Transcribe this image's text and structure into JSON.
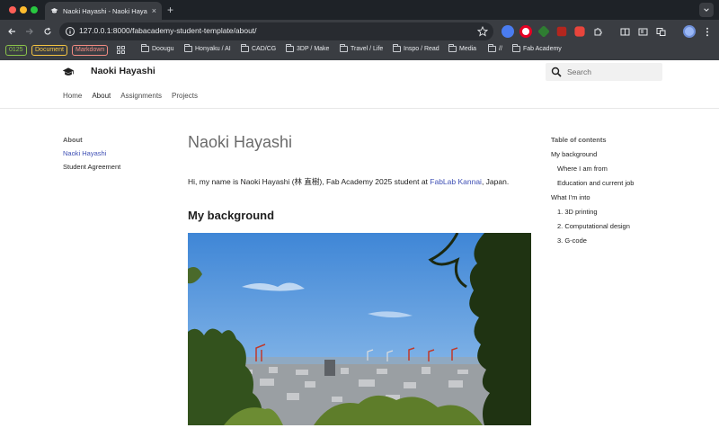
{
  "browser": {
    "tab_title": "Naoki Hayashi - Naoki Hayashi",
    "tab_close": "×",
    "new_tab": "+",
    "url": "127.0.0.1:8000/fabacademy-student-template/about/"
  },
  "bookmarks": {
    "tags": [
      {
        "label": "0125",
        "color": "#8bc34a"
      },
      {
        "label": "Document",
        "color": "#f5c542"
      },
      {
        "label": "Markdown",
        "color": "#f28b82"
      }
    ],
    "folders": [
      "Doougu",
      "Honyaku / AI",
      "CAD/CG",
      "3DP / Make",
      "Travel / Life",
      "Inspo / Read",
      "Media",
      "//",
      "Fab Academy"
    ]
  },
  "site": {
    "title": "Naoki Hayashi",
    "search_placeholder": "Search",
    "nav": [
      "Home",
      "About",
      "Assignments",
      "Projects"
    ]
  },
  "sidebar": {
    "heading": "About",
    "items": [
      "Naoki Hayashi",
      "Student Agreement"
    ]
  },
  "main": {
    "title": "Naoki Hayashi",
    "intro_before": "Hi, my name is Naoki Hayashi (林 直樹), Fab Academy 2025 student at ",
    "intro_link": "FabLab Kannai",
    "intro_after": ", Japan.",
    "section_heading": "My background"
  },
  "toc": {
    "heading": "Table of contents",
    "items": [
      "My background",
      "Where I am from",
      "Education and current job",
      "What I'm into",
      "1. 3D printing",
      "2. Computational design",
      "3. G-code"
    ]
  },
  "colors": {
    "accent": "#4051b5",
    "chrome_dark": "#1e2227",
    "chrome_toolbar": "#3a3d42"
  }
}
